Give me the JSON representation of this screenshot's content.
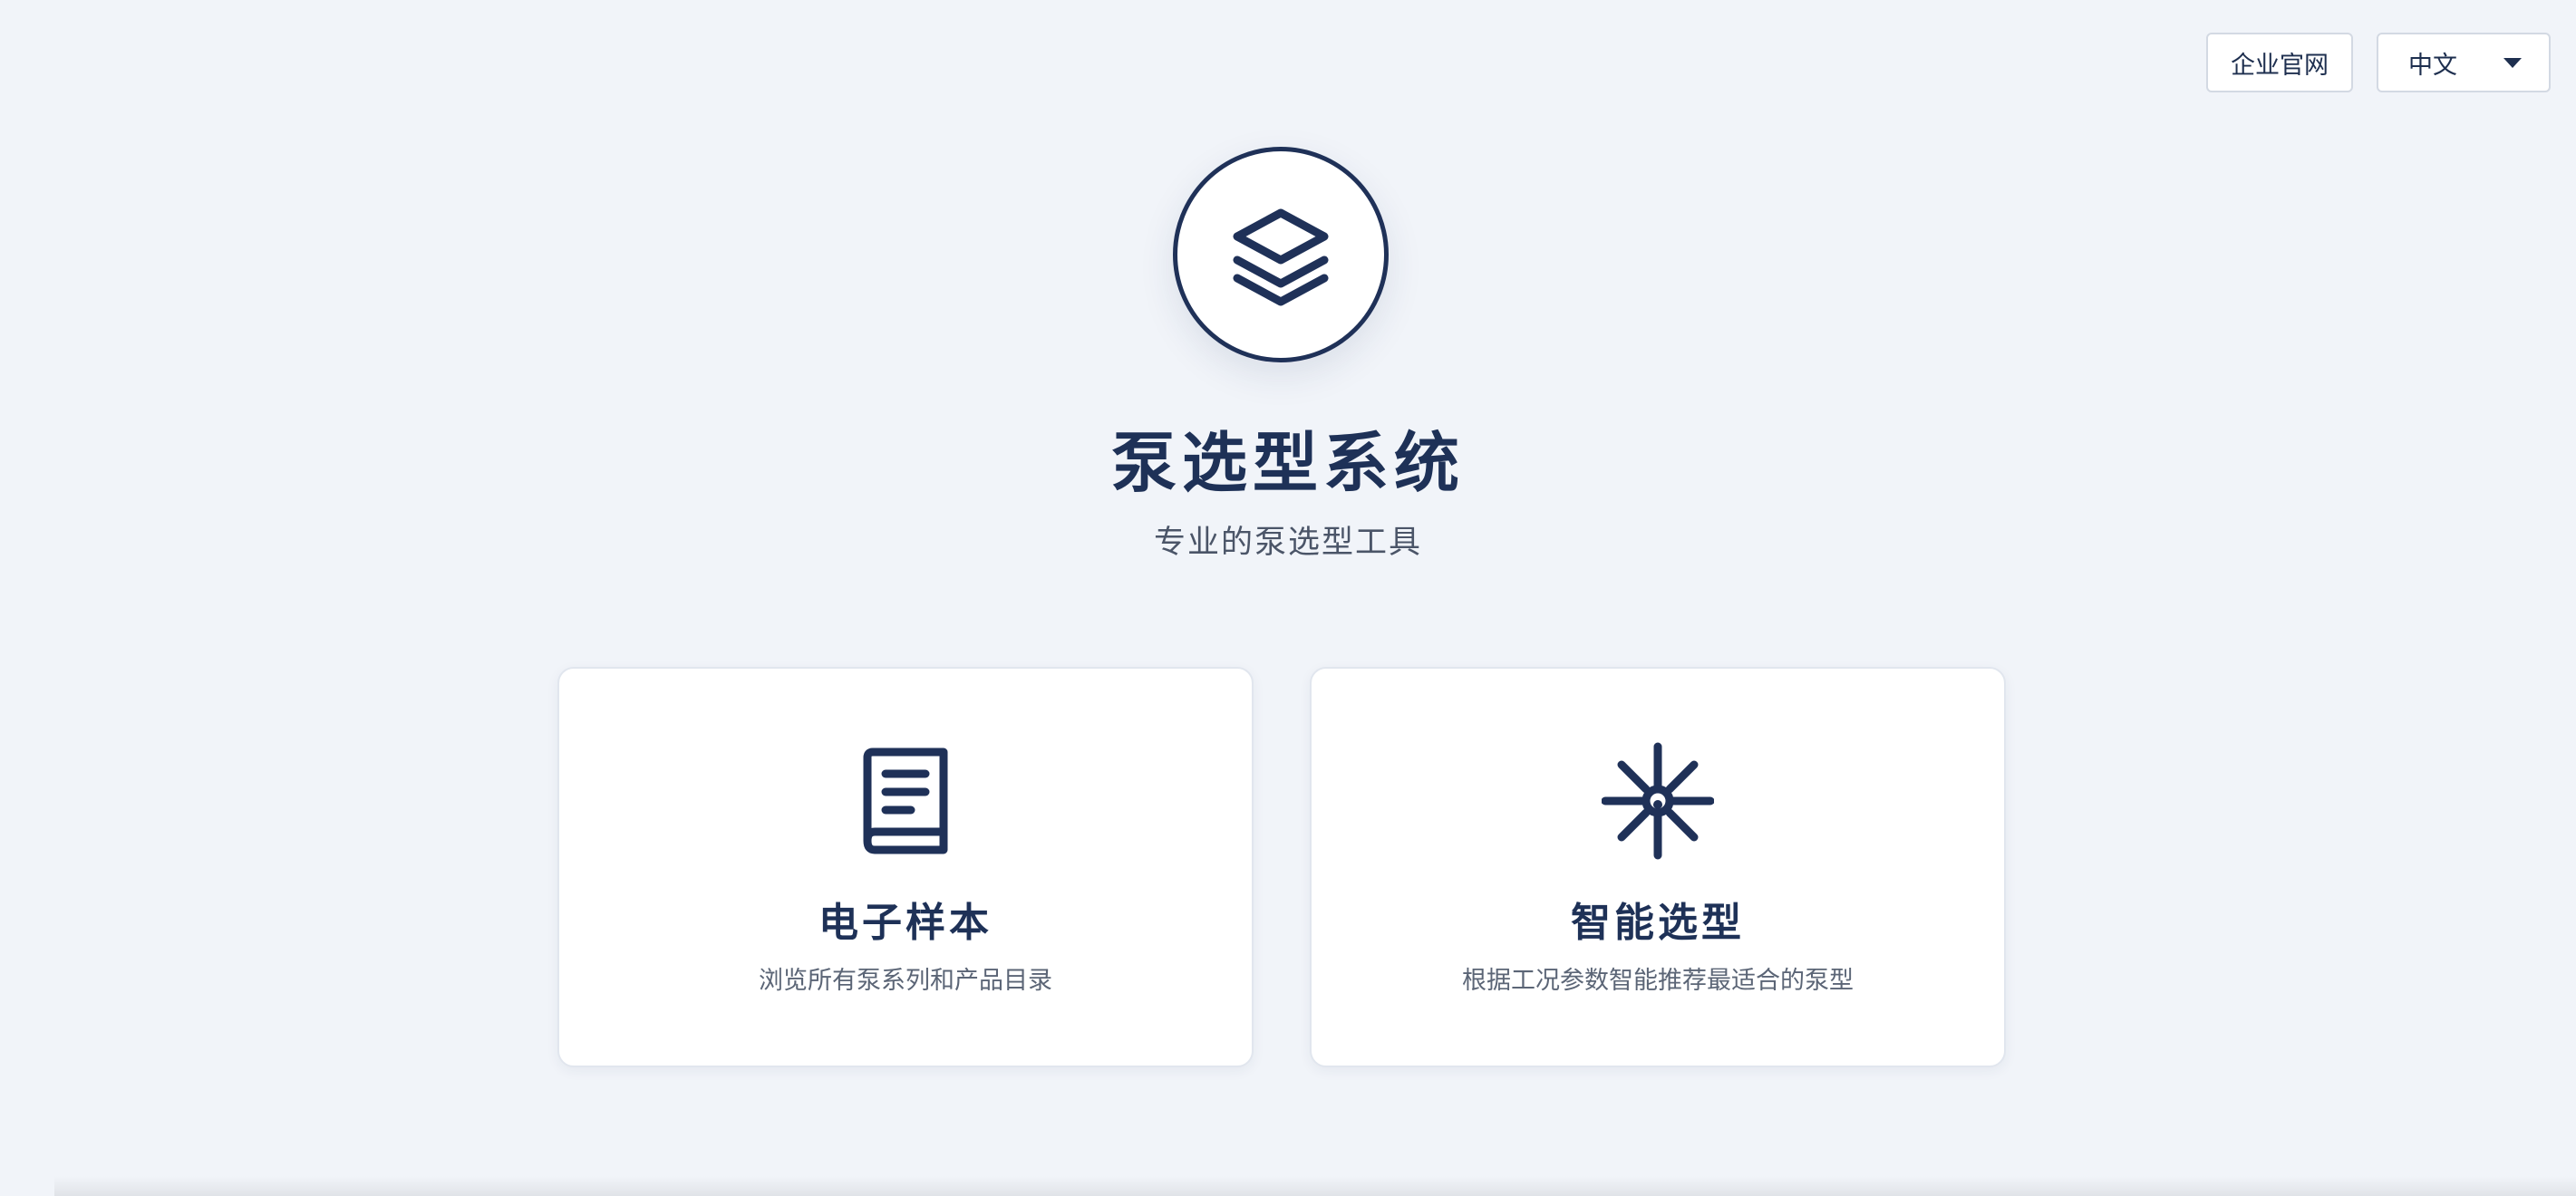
{
  "header": {
    "site_button": "企业官网",
    "language_select": {
      "selected": "中文"
    }
  },
  "hero": {
    "icon": "layers-icon",
    "title": "泵选型系统",
    "subtitle": "专业的泵选型工具"
  },
  "cards": [
    {
      "icon": "book-icon",
      "title": "电子样本",
      "description": "浏览所有泵系列和产品目录"
    },
    {
      "icon": "sparkle-icon",
      "title": "智能选型",
      "description": "根据工况参数智能推荐最适合的泵型"
    }
  ],
  "colors": {
    "background": "#f1f4f9",
    "primary": "#1e3157",
    "card_background": "#ffffff",
    "muted_text": "#5b6576"
  }
}
